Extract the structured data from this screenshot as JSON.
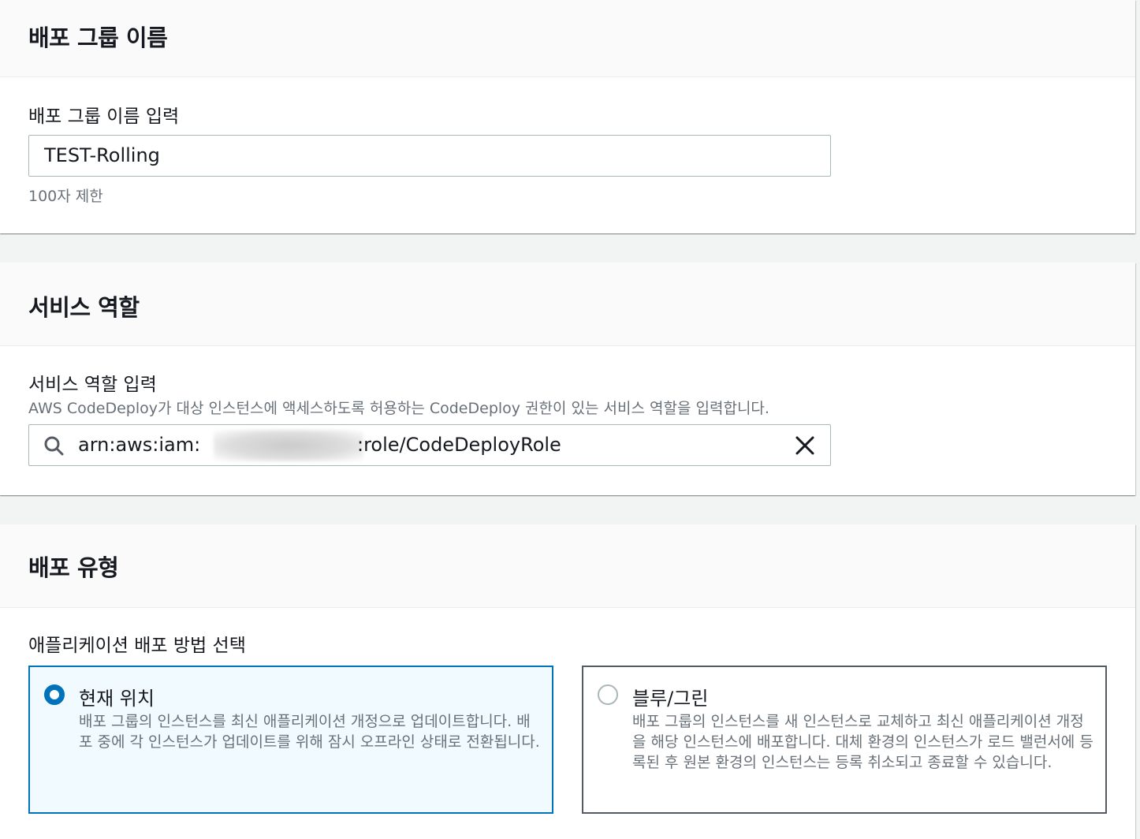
{
  "deployment_group": {
    "title": "배포 그룹 이름",
    "input_label": "배포 그룹 이름 입력",
    "input_value": "TEST-Rolling",
    "constraint": "100자 제한"
  },
  "service_role": {
    "title": "서비스 역할",
    "input_label": "서비스 역할 입력",
    "description": "AWS CodeDeploy가 대상 인스턴스에 액세스하도록 허용하는 CodeDeploy 권한이 있는 서비스 역할을 입력합니다.",
    "value_prefix": "arn:aws:iam:",
    "value_suffix": ":role/CodeDeployRole"
  },
  "deployment_type": {
    "title": "배포 유형",
    "method_label": "애플리케이션 배포 방법 선택",
    "options": [
      {
        "title": "현재 위치",
        "description": "배포 그룹의 인스턴스를 최신 애플리케이션 개정으로 업데이트합니다. 배포 중에 각 인스턴스가 업데이트를 위해 잠시 오프라인 상태로 전환됩니다.",
        "selected": true
      },
      {
        "title": "블루/그린",
        "description": "배포 그룹의 인스턴스를 새 인스턴스로 교체하고 최신 애플리케이션 개정을 해당 인스턴스에 배포합니다. 대체 환경의 인스턴스가 로드 밸런서에 등록된 후 원본 환경의 인스턴스는 등록 취소되고 종료할 수 있습니다.",
        "selected": false
      }
    ]
  },
  "icons": {
    "search": "search-icon",
    "clear": "close-icon"
  },
  "colors": {
    "accent": "#0073bb",
    "selected_tile_bg": "#f1faff",
    "text": "#16191f",
    "secondary_text": "#687078"
  }
}
